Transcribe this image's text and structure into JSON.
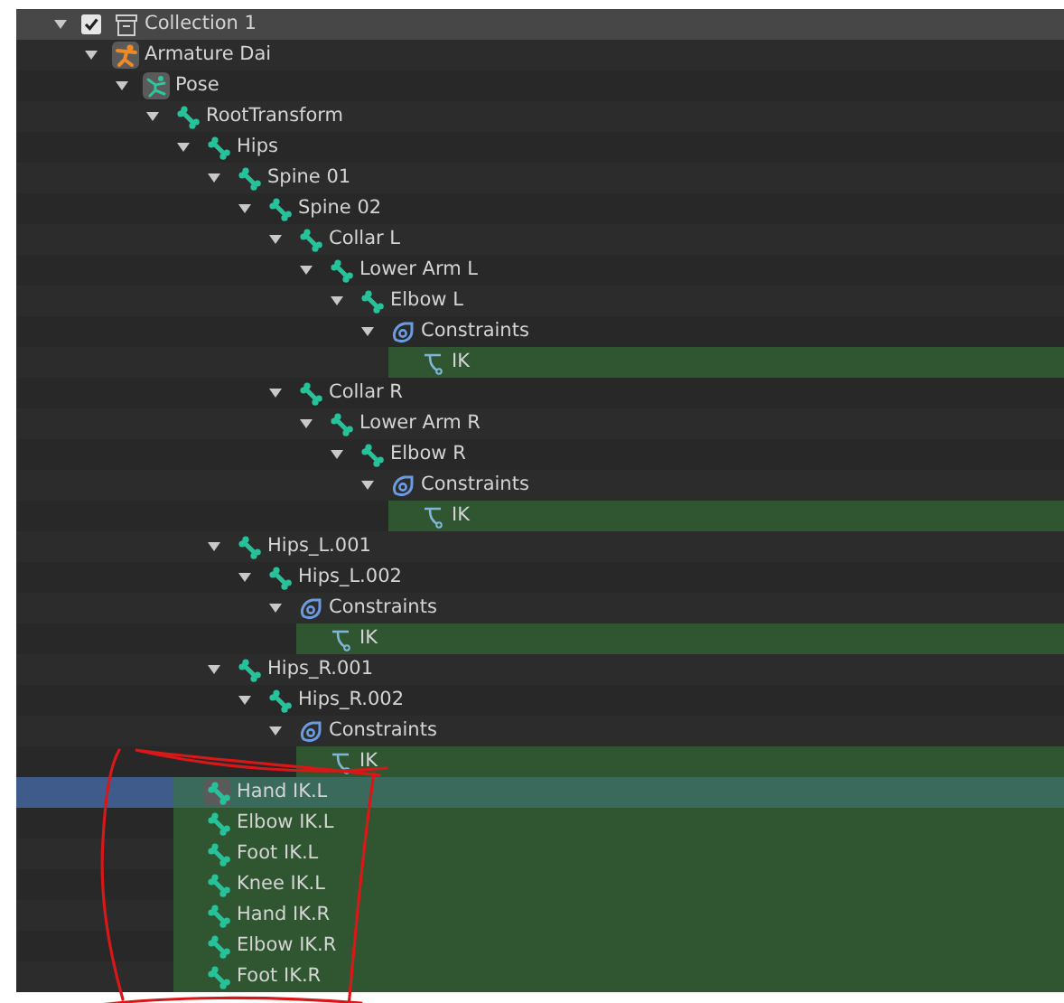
{
  "tree": [
    {
      "kind": "collection",
      "label": "Collection 1",
      "checked": true,
      "expanded": true,
      "hovered": true,
      "selected": false,
      "highlighted": false,
      "active": false,
      "children": [
        {
          "kind": "armature",
          "label": "Armature Dai",
          "expanded": true,
          "hovered": false,
          "selected": false,
          "highlighted": false,
          "active": true,
          "children": [
            {
              "kind": "pose",
              "label": "Pose",
              "expanded": true,
              "hovered": false,
              "selected": false,
              "highlighted": false,
              "active": true,
              "children": [
                {
                  "kind": "bone",
                  "label": "RootTransform",
                  "expanded": true,
                  "hovered": false,
                  "selected": false,
                  "highlighted": false,
                  "active": false,
                  "children": [
                    {
                      "kind": "bone",
                      "label": "Hips",
                      "expanded": true,
                      "hovered": false,
                      "selected": false,
                      "highlighted": false,
                      "active": false,
                      "children": [
                        {
                          "kind": "bone",
                          "label": "Spine 01",
                          "expanded": true,
                          "hovered": false,
                          "selected": false,
                          "highlighted": false,
                          "active": false,
                          "children": [
                            {
                              "kind": "bone",
                              "label": "Spine 02",
                              "expanded": true,
                              "hovered": false,
                              "selected": false,
                              "highlighted": false,
                              "active": false,
                              "children": [
                                {
                                  "kind": "bone",
                                  "label": "Collar L",
                                  "expanded": true,
                                  "hovered": false,
                                  "selected": false,
                                  "highlighted": false,
                                  "active": false,
                                  "children": [
                                    {
                                      "kind": "bone",
                                      "label": "Lower Arm L",
                                      "expanded": true,
                                      "hovered": false,
                                      "selected": false,
                                      "highlighted": false,
                                      "active": false,
                                      "children": [
                                        {
                                          "kind": "bone",
                                          "label": "Elbow L",
                                          "expanded": true,
                                          "hovered": false,
                                          "selected": false,
                                          "highlighted": false,
                                          "active": false,
                                          "children": [
                                            {
                                              "kind": "constraints",
                                              "label": "Constraints",
                                              "expanded": true,
                                              "hovered": false,
                                              "selected": false,
                                              "highlighted": false,
                                              "active": false,
                                              "children": [
                                                {
                                                  "kind": "ik",
                                                  "label": "IK",
                                                  "hovered": false,
                                                  "selected": false,
                                                  "highlighted": true,
                                                  "active": false
                                                }
                                              ]
                                            }
                                          ]
                                        }
                                      ]
                                    }
                                  ]
                                },
                                {
                                  "kind": "bone",
                                  "label": "Collar R",
                                  "expanded": true,
                                  "hovered": false,
                                  "selected": false,
                                  "highlighted": false,
                                  "active": false,
                                  "children": [
                                    {
                                      "kind": "bone",
                                      "label": "Lower Arm R",
                                      "expanded": true,
                                      "hovered": false,
                                      "selected": false,
                                      "highlighted": false,
                                      "active": false,
                                      "children": [
                                        {
                                          "kind": "bone",
                                          "label": "Elbow R",
                                          "expanded": true,
                                          "hovered": false,
                                          "selected": false,
                                          "highlighted": false,
                                          "active": false,
                                          "children": [
                                            {
                                              "kind": "constraints",
                                              "label": "Constraints",
                                              "expanded": true,
                                              "hovered": false,
                                              "selected": false,
                                              "highlighted": false,
                                              "active": false,
                                              "children": [
                                                {
                                                  "kind": "ik",
                                                  "label": "IK",
                                                  "hovered": false,
                                                  "selected": false,
                                                  "highlighted": true,
                                                  "active": false
                                                }
                                              ]
                                            }
                                          ]
                                        }
                                      ]
                                    }
                                  ]
                                }
                              ]
                            }
                          ]
                        },
                        {
                          "kind": "bone",
                          "label": "Hips_L.001",
                          "expanded": true,
                          "hovered": false,
                          "selected": false,
                          "highlighted": false,
                          "active": false,
                          "children": [
                            {
                              "kind": "bone",
                              "label": "Hips_L.002",
                              "expanded": true,
                              "hovered": false,
                              "selected": false,
                              "highlighted": false,
                              "active": false,
                              "children": [
                                {
                                  "kind": "constraints",
                                  "label": "Constraints",
                                  "expanded": true,
                                  "hovered": false,
                                  "selected": false,
                                  "highlighted": false,
                                  "active": false,
                                  "children": [
                                    {
                                      "kind": "ik",
                                      "label": "IK",
                                      "hovered": false,
                                      "selected": false,
                                      "highlighted": true,
                                      "active": false
                                    }
                                  ]
                                }
                              ]
                            }
                          ]
                        },
                        {
                          "kind": "bone",
                          "label": "Hips_R.001",
                          "expanded": true,
                          "hovered": false,
                          "selected": false,
                          "highlighted": false,
                          "active": false,
                          "children": [
                            {
                              "kind": "bone",
                              "label": "Hips_R.002",
                              "expanded": true,
                              "hovered": false,
                              "selected": false,
                              "highlighted": false,
                              "active": false,
                              "children": [
                                {
                                  "kind": "constraints",
                                  "label": "Constraints",
                                  "expanded": true,
                                  "hovered": false,
                                  "selected": false,
                                  "highlighted": false,
                                  "active": false,
                                  "children": [
                                    {
                                      "kind": "ik",
                                      "label": "IK",
                                      "hovered": false,
                                      "selected": false,
                                      "highlighted": true,
                                      "active": false
                                    }
                                  ]
                                }
                              ]
                            }
                          ]
                        }
                      ]
                    },
                    {
                      "kind": "bone",
                      "label": "Hand IK.L",
                      "hovered": false,
                      "selected": true,
                      "highlighted": true,
                      "active": true
                    },
                    {
                      "kind": "bone",
                      "label": "Elbow IK.L",
                      "hovered": false,
                      "selected": false,
                      "highlighted": true,
                      "active": false
                    },
                    {
                      "kind": "bone",
                      "label": "Foot IK.L",
                      "hovered": false,
                      "selected": false,
                      "highlighted": true,
                      "active": false
                    },
                    {
                      "kind": "bone",
                      "label": "Knee IK.L",
                      "hovered": false,
                      "selected": false,
                      "highlighted": true,
                      "active": false
                    },
                    {
                      "kind": "bone",
                      "label": "Hand IK.R",
                      "hovered": false,
                      "selected": false,
                      "highlighted": true,
                      "active": false
                    },
                    {
                      "kind": "bone",
                      "label": "Elbow IK.R",
                      "hovered": false,
                      "selected": false,
                      "highlighted": true,
                      "active": false
                    },
                    {
                      "kind": "bone",
                      "label": "Foot IK.R",
                      "hovered": false,
                      "selected": false,
                      "highlighted": true,
                      "active": false
                    }
                  ]
                }
              ]
            }
          ]
        }
      ]
    }
  ],
  "annotation": {
    "kind": "freehand-loop"
  }
}
